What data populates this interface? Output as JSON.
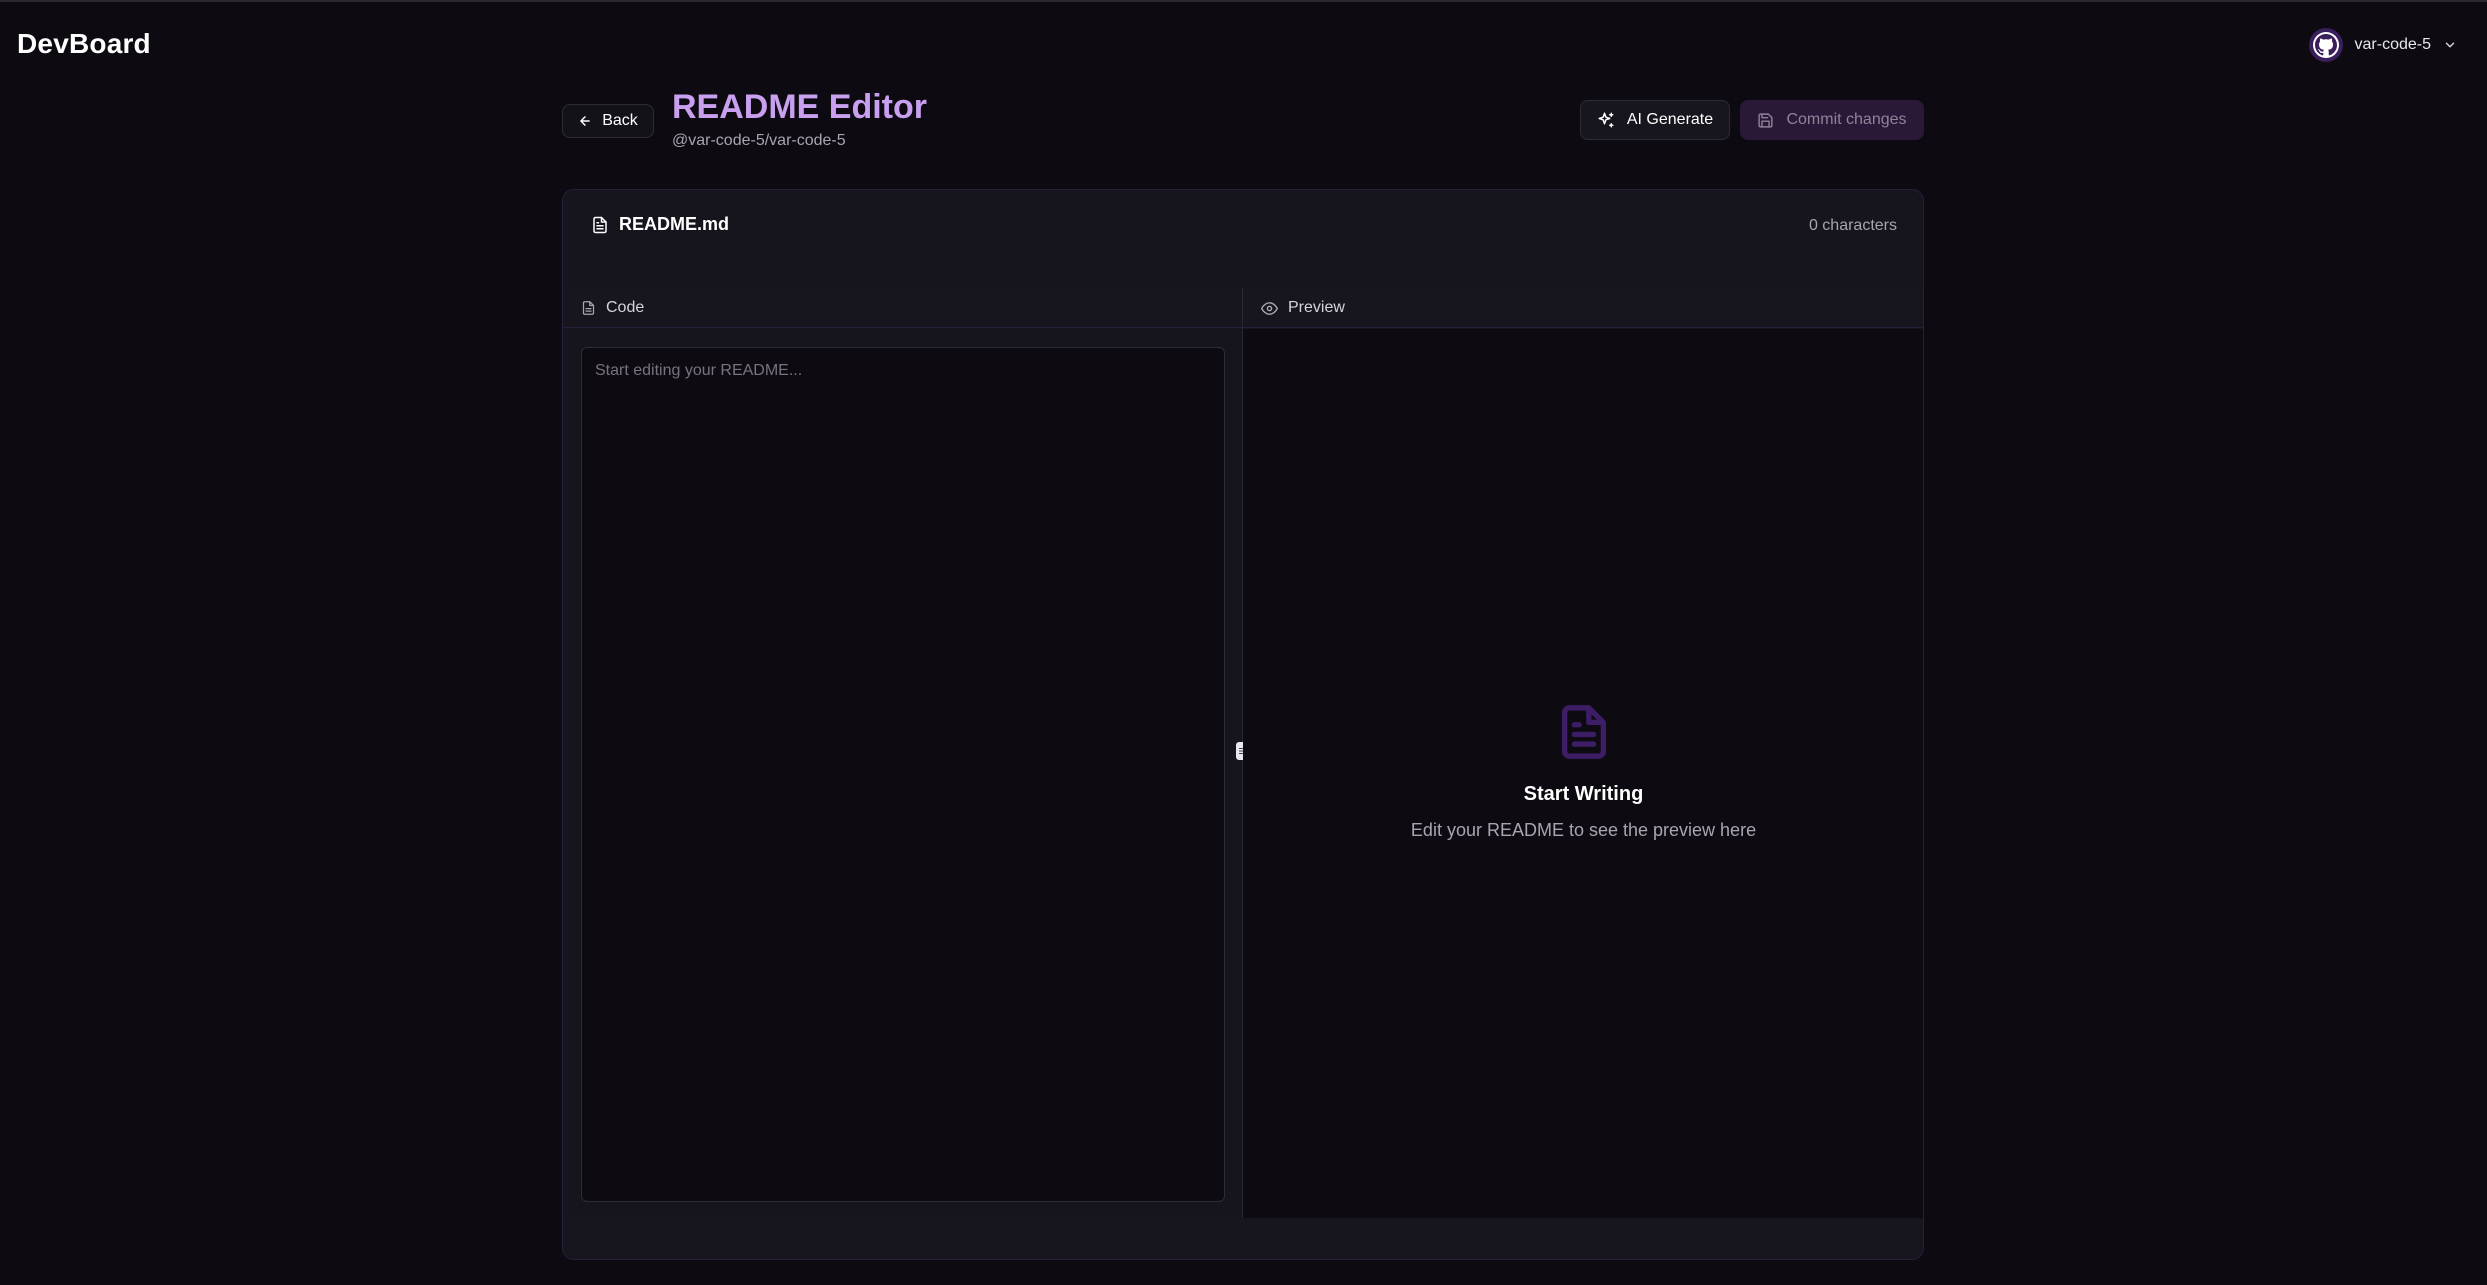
{
  "app": {
    "brand": "DevBoard"
  },
  "user": {
    "name": "var-code-5",
    "avatar_icon": "github-icon"
  },
  "header": {
    "back_label": "Back",
    "title": "README Editor",
    "repo_path": "@var-code-5/var-code-5",
    "ai_generate_label": "AI Generate",
    "commit_label": "Commit changes"
  },
  "editor": {
    "file_name": "README.md",
    "char_count": "0 characters",
    "code_tab_label": "Code",
    "preview_tab_label": "Preview",
    "textarea_value": "",
    "textarea_placeholder": "Start editing your README..."
  },
  "preview": {
    "empty_title": "Start Writing",
    "empty_subtitle": "Edit your README to see the preview here"
  },
  "colors": {
    "background": "#0d0b11",
    "accent": "#c9a0f0",
    "accent_dark": "#3a1f5c",
    "card_border": "#2a1f3a"
  }
}
